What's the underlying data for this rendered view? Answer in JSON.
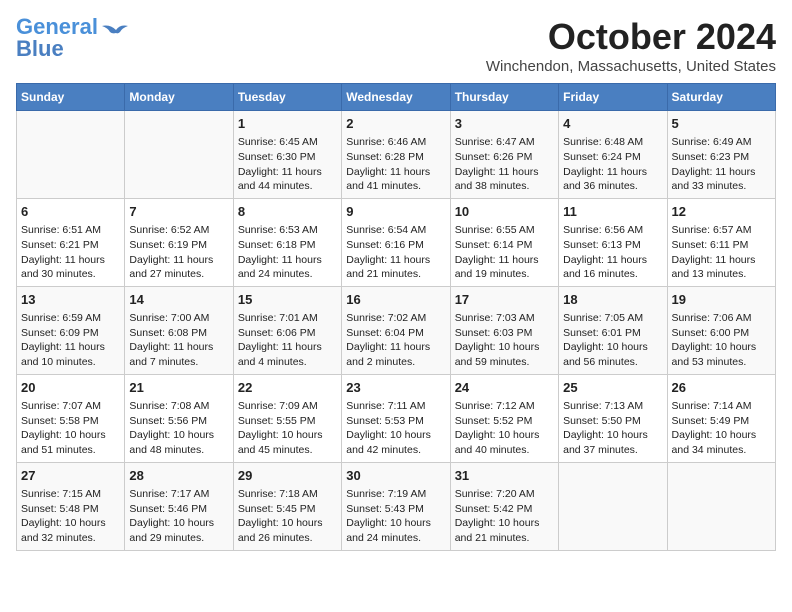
{
  "header": {
    "logo_line1": "General",
    "logo_line2": "Blue",
    "month": "October 2024",
    "location": "Winchendon, Massachusetts, United States"
  },
  "columns": [
    "Sunday",
    "Monday",
    "Tuesday",
    "Wednesday",
    "Thursday",
    "Friday",
    "Saturday"
  ],
  "weeks": [
    [
      {
        "day": "",
        "sunrise": "",
        "sunset": "",
        "daylight": ""
      },
      {
        "day": "",
        "sunrise": "",
        "sunset": "",
        "daylight": ""
      },
      {
        "day": "1",
        "sunrise": "Sunrise: 6:45 AM",
        "sunset": "Sunset: 6:30 PM",
        "daylight": "Daylight: 11 hours and 44 minutes."
      },
      {
        "day": "2",
        "sunrise": "Sunrise: 6:46 AM",
        "sunset": "Sunset: 6:28 PM",
        "daylight": "Daylight: 11 hours and 41 minutes."
      },
      {
        "day": "3",
        "sunrise": "Sunrise: 6:47 AM",
        "sunset": "Sunset: 6:26 PM",
        "daylight": "Daylight: 11 hours and 38 minutes."
      },
      {
        "day": "4",
        "sunrise": "Sunrise: 6:48 AM",
        "sunset": "Sunset: 6:24 PM",
        "daylight": "Daylight: 11 hours and 36 minutes."
      },
      {
        "day": "5",
        "sunrise": "Sunrise: 6:49 AM",
        "sunset": "Sunset: 6:23 PM",
        "daylight": "Daylight: 11 hours and 33 minutes."
      }
    ],
    [
      {
        "day": "6",
        "sunrise": "Sunrise: 6:51 AM",
        "sunset": "Sunset: 6:21 PM",
        "daylight": "Daylight: 11 hours and 30 minutes."
      },
      {
        "day": "7",
        "sunrise": "Sunrise: 6:52 AM",
        "sunset": "Sunset: 6:19 PM",
        "daylight": "Daylight: 11 hours and 27 minutes."
      },
      {
        "day": "8",
        "sunrise": "Sunrise: 6:53 AM",
        "sunset": "Sunset: 6:18 PM",
        "daylight": "Daylight: 11 hours and 24 minutes."
      },
      {
        "day": "9",
        "sunrise": "Sunrise: 6:54 AM",
        "sunset": "Sunset: 6:16 PM",
        "daylight": "Daylight: 11 hours and 21 minutes."
      },
      {
        "day": "10",
        "sunrise": "Sunrise: 6:55 AM",
        "sunset": "Sunset: 6:14 PM",
        "daylight": "Daylight: 11 hours and 19 minutes."
      },
      {
        "day": "11",
        "sunrise": "Sunrise: 6:56 AM",
        "sunset": "Sunset: 6:13 PM",
        "daylight": "Daylight: 11 hours and 16 minutes."
      },
      {
        "day": "12",
        "sunrise": "Sunrise: 6:57 AM",
        "sunset": "Sunset: 6:11 PM",
        "daylight": "Daylight: 11 hours and 13 minutes."
      }
    ],
    [
      {
        "day": "13",
        "sunrise": "Sunrise: 6:59 AM",
        "sunset": "Sunset: 6:09 PM",
        "daylight": "Daylight: 11 hours and 10 minutes."
      },
      {
        "day": "14",
        "sunrise": "Sunrise: 7:00 AM",
        "sunset": "Sunset: 6:08 PM",
        "daylight": "Daylight: 11 hours and 7 minutes."
      },
      {
        "day": "15",
        "sunrise": "Sunrise: 7:01 AM",
        "sunset": "Sunset: 6:06 PM",
        "daylight": "Daylight: 11 hours and 4 minutes."
      },
      {
        "day": "16",
        "sunrise": "Sunrise: 7:02 AM",
        "sunset": "Sunset: 6:04 PM",
        "daylight": "Daylight: 11 hours and 2 minutes."
      },
      {
        "day": "17",
        "sunrise": "Sunrise: 7:03 AM",
        "sunset": "Sunset: 6:03 PM",
        "daylight": "Daylight: 10 hours and 59 minutes."
      },
      {
        "day": "18",
        "sunrise": "Sunrise: 7:05 AM",
        "sunset": "Sunset: 6:01 PM",
        "daylight": "Daylight: 10 hours and 56 minutes."
      },
      {
        "day": "19",
        "sunrise": "Sunrise: 7:06 AM",
        "sunset": "Sunset: 6:00 PM",
        "daylight": "Daylight: 10 hours and 53 minutes."
      }
    ],
    [
      {
        "day": "20",
        "sunrise": "Sunrise: 7:07 AM",
        "sunset": "Sunset: 5:58 PM",
        "daylight": "Daylight: 10 hours and 51 minutes."
      },
      {
        "day": "21",
        "sunrise": "Sunrise: 7:08 AM",
        "sunset": "Sunset: 5:56 PM",
        "daylight": "Daylight: 10 hours and 48 minutes."
      },
      {
        "day": "22",
        "sunrise": "Sunrise: 7:09 AM",
        "sunset": "Sunset: 5:55 PM",
        "daylight": "Daylight: 10 hours and 45 minutes."
      },
      {
        "day": "23",
        "sunrise": "Sunrise: 7:11 AM",
        "sunset": "Sunset: 5:53 PM",
        "daylight": "Daylight: 10 hours and 42 minutes."
      },
      {
        "day": "24",
        "sunrise": "Sunrise: 7:12 AM",
        "sunset": "Sunset: 5:52 PM",
        "daylight": "Daylight: 10 hours and 40 minutes."
      },
      {
        "day": "25",
        "sunrise": "Sunrise: 7:13 AM",
        "sunset": "Sunset: 5:50 PM",
        "daylight": "Daylight: 10 hours and 37 minutes."
      },
      {
        "day": "26",
        "sunrise": "Sunrise: 7:14 AM",
        "sunset": "Sunset: 5:49 PM",
        "daylight": "Daylight: 10 hours and 34 minutes."
      }
    ],
    [
      {
        "day": "27",
        "sunrise": "Sunrise: 7:15 AM",
        "sunset": "Sunset: 5:48 PM",
        "daylight": "Daylight: 10 hours and 32 minutes."
      },
      {
        "day": "28",
        "sunrise": "Sunrise: 7:17 AM",
        "sunset": "Sunset: 5:46 PM",
        "daylight": "Daylight: 10 hours and 29 minutes."
      },
      {
        "day": "29",
        "sunrise": "Sunrise: 7:18 AM",
        "sunset": "Sunset: 5:45 PM",
        "daylight": "Daylight: 10 hours and 26 minutes."
      },
      {
        "day": "30",
        "sunrise": "Sunrise: 7:19 AM",
        "sunset": "Sunset: 5:43 PM",
        "daylight": "Daylight: 10 hours and 24 minutes."
      },
      {
        "day": "31",
        "sunrise": "Sunrise: 7:20 AM",
        "sunset": "Sunset: 5:42 PM",
        "daylight": "Daylight: 10 hours and 21 minutes."
      },
      {
        "day": "",
        "sunrise": "",
        "sunset": "",
        "daylight": ""
      },
      {
        "day": "",
        "sunrise": "",
        "sunset": "",
        "daylight": ""
      }
    ]
  ]
}
